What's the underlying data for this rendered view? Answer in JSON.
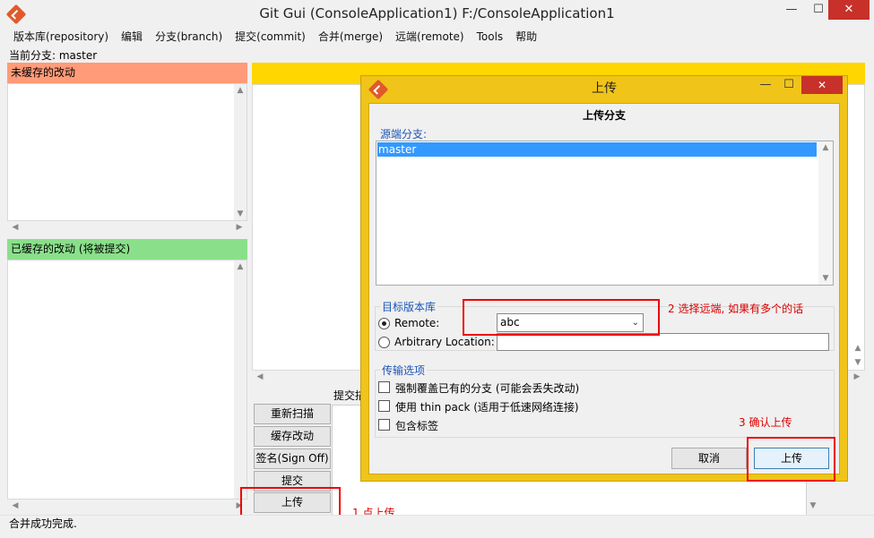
{
  "window": {
    "title": "Git Gui (ConsoleApplication1) F:/ConsoleApplication1",
    "minimize": "—",
    "maximize": "☐",
    "close": "✕"
  },
  "menu": [
    "版本库(repository)",
    "编辑",
    "分支(branch)",
    "提交(commit)",
    "合并(merge)",
    "远端(remote)",
    "Tools",
    "帮助"
  ],
  "current_branch": "当前分支: master",
  "unstaged_header": "未缓存的改动",
  "staged_header": "已缓存的改动 (将被提交)",
  "commit_message_label": "提交描",
  "buttons": {
    "rescan": "重新扫描",
    "stage": "缓存改动",
    "signoff": "签名(Sign Off)",
    "commit": "提交",
    "push": "上传"
  },
  "status": "合并成功完成.",
  "colors": {
    "unstaged": "#ff9b79",
    "staged": "#8ae08a",
    "diff_header": "#ffd600",
    "dialog_frame": "#f0c419",
    "selection": "#3399ff",
    "annotation": "#e00000"
  },
  "annotations": {
    "step1": "1 点上传",
    "step2": "2 选择远端, 如果有多个的话",
    "step3": "3 确认上传"
  },
  "dialog": {
    "title": "上传",
    "subtitle": "上传分支",
    "source_branch_label": "源端分支:",
    "branches": [
      "master"
    ],
    "destination_label": "目标版本库",
    "remote_label": "Remote:",
    "remote_value": "abc",
    "arbitrary_label": "Arbitrary Location:",
    "transfer_label": "传输选项",
    "options": {
      "force": "强制覆盖已有的分支 (可能会丢失改动)",
      "thin": "使用 thin pack (适用于低速网络连接)",
      "tags": "包含标签"
    },
    "cancel": "取消",
    "push": "上传",
    "minimize": "—",
    "maximize": "☐",
    "close": "✕"
  }
}
